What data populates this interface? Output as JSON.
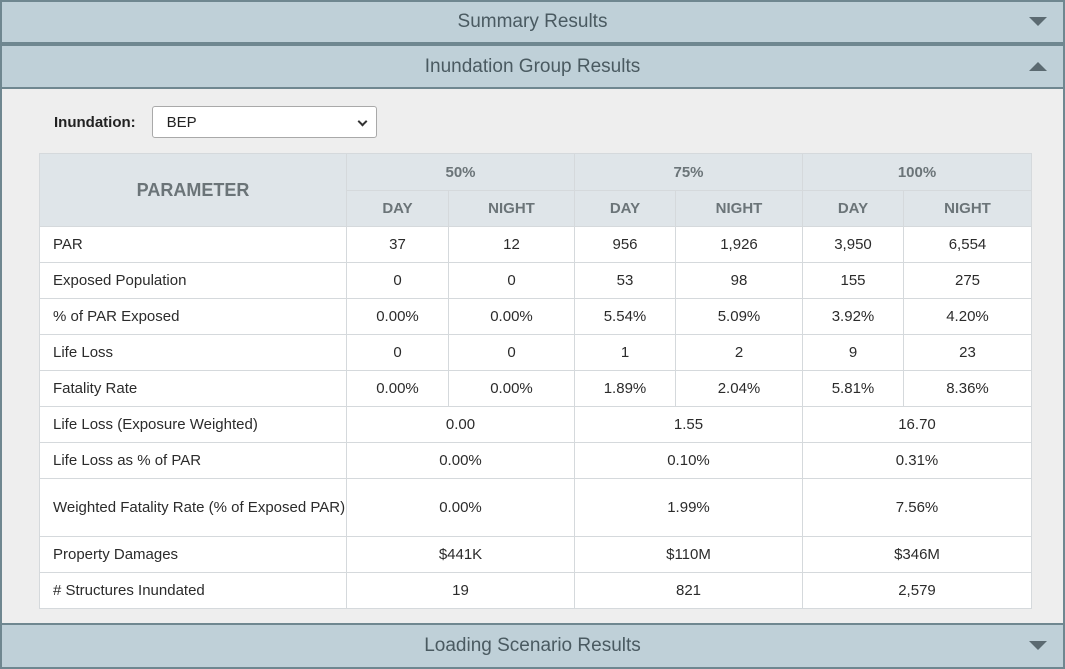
{
  "panels": {
    "summary": "Summary Results",
    "inundation": "Inundation Group Results",
    "loading": "Loading Scenario Results"
  },
  "filter": {
    "label": "Inundation:",
    "selected": "BEP"
  },
  "table": {
    "param_header": "PARAMETER",
    "groups": [
      "50%",
      "75%",
      "100%"
    ],
    "sub": {
      "day": "DAY",
      "night": "NIGHT"
    },
    "rows": [
      {
        "label": "PAR",
        "values": [
          "37",
          "12",
          "956",
          "1,926",
          "3,950",
          "6,554"
        ]
      },
      {
        "label": "Exposed Population",
        "values": [
          "0",
          "0",
          "53",
          "98",
          "155",
          "275"
        ]
      },
      {
        "label": "% of PAR Exposed",
        "values": [
          "0.00%",
          "0.00%",
          "5.54%",
          "5.09%",
          "3.92%",
          "4.20%"
        ]
      },
      {
        "label": "Life Loss",
        "values": [
          "0",
          "0",
          "1",
          "2",
          "9",
          "23"
        ]
      },
      {
        "label": "Fatality Rate",
        "values": [
          "0.00%",
          "0.00%",
          "1.89%",
          "2.04%",
          "5.81%",
          "8.36%"
        ]
      }
    ],
    "merged_rows": [
      {
        "label": "Life Loss (Exposure Weighted)",
        "values": [
          "0.00",
          "1.55",
          "16.70"
        ]
      },
      {
        "label": "Life Loss as % of PAR",
        "values": [
          "0.00%",
          "0.10%",
          "0.31%"
        ]
      },
      {
        "label": "Weighted Fatality Rate (% of Exposed PAR)",
        "values": [
          "0.00%",
          "1.99%",
          "7.56%"
        ]
      },
      {
        "label": "Property Damages",
        "values": [
          "$441K",
          "$110M",
          "$346M"
        ]
      },
      {
        "label": "# Structures Inundated",
        "values": [
          "19",
          "821",
          "2,579"
        ]
      }
    ]
  }
}
